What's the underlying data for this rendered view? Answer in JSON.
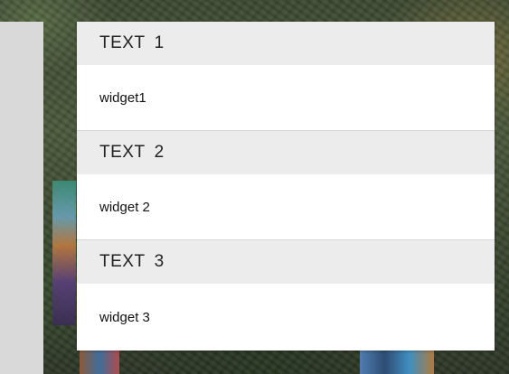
{
  "accordion": {
    "sections": [
      {
        "header_word": "TEXT",
        "header_num": "1",
        "content": "widget1"
      },
      {
        "header_word": "TEXT",
        "header_num": "2",
        "content": "widget 2"
      },
      {
        "header_word": "TEXT",
        "header_num": "3",
        "content": "widget 3"
      }
    ]
  },
  "colors": {
    "header_bg": "#ececec",
    "content_bg": "#ffffff",
    "side_panel": "#d9d9d9"
  }
}
